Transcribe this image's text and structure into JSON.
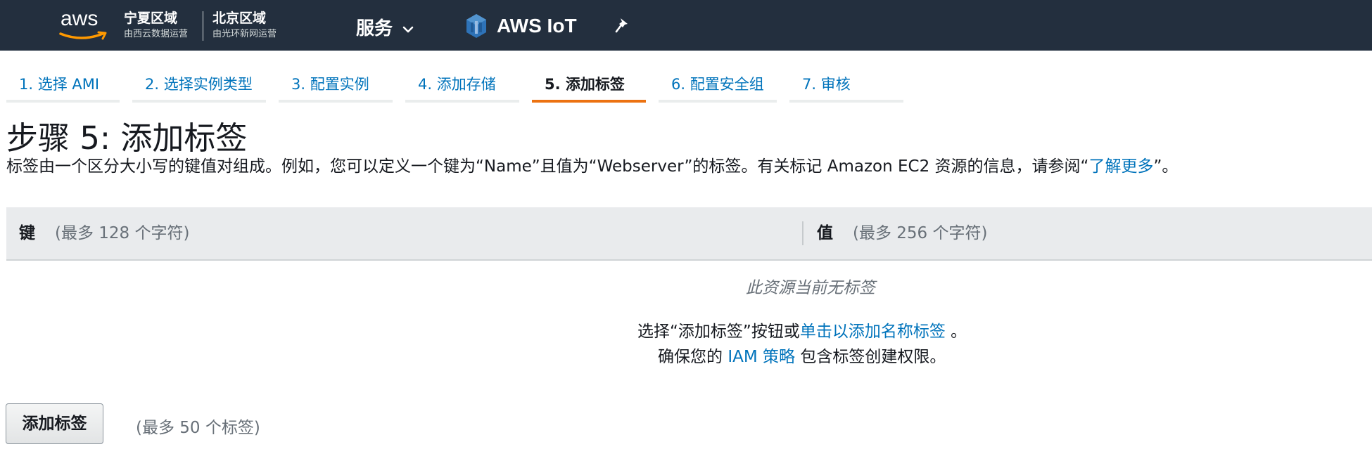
{
  "header": {
    "brand": "aws",
    "region1": {
      "title": "宁夏区域",
      "subtitle": "由西云数据运营"
    },
    "region2": {
      "title": "北京区域",
      "subtitle": "由光环新网运营"
    },
    "services_label": "服务",
    "service_name": "AWS IoT",
    "icons": {
      "services_menu": "chevron-down-icon",
      "iot": "aws-iot-icon",
      "pin": "pin-icon"
    },
    "colors": {
      "nav_bg": "#232f3e",
      "logo_smile": "#ff9900"
    }
  },
  "wizard": {
    "tabs": [
      {
        "label": "1. 选择 AMI",
        "active": false
      },
      {
        "label": "2. 选择实例类型",
        "active": false
      },
      {
        "label": "3. 配置实例",
        "active": false
      },
      {
        "label": "4. 添加存储",
        "active": false
      },
      {
        "label": "5. 添加标签",
        "active": true
      },
      {
        "label": "6. 配置安全组",
        "active": false
      },
      {
        "label": "7. 审核",
        "active": false
      }
    ],
    "active_color": "#ec7211"
  },
  "page": {
    "title": "步骤 5: 添加标签",
    "desc_prefix": "标签由一个区分大小写的键值对组成。例如，您可以定义一个键为“Name”且值为“Webserver”的标签。有关标记 Amazon EC2 资源的信息，请参阅“",
    "desc_link": "了解更多",
    "desc_suffix": "”。"
  },
  "table": {
    "key_header": "键",
    "key_hint": "(最多 128 个字符)",
    "value_header": "值",
    "value_hint": "(最多 256 个字符)",
    "empty_message": "此资源当前无标签",
    "line1_prefix": "选择“添加标签”按钮或",
    "line1_link": "单击以添加名称标签",
    "line1_suffix": "。",
    "line2_prefix": "确保您的",
    "line2_link": "IAM 策略",
    "line2_suffix": "包含标签创建权限。"
  },
  "actions": {
    "add_tag_label": "添加标签",
    "add_tag_limit": "(最多 50 个标签)"
  }
}
